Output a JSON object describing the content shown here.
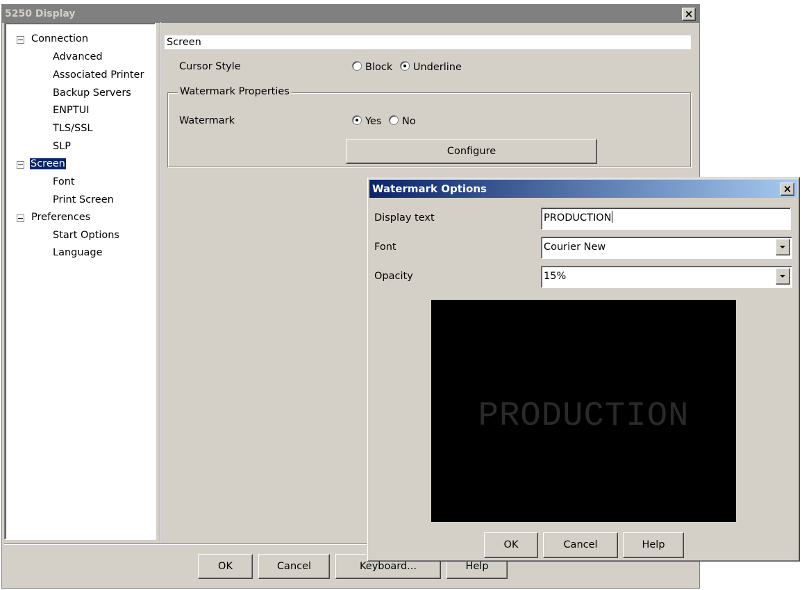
{
  "main_window": {
    "title": "5250 Display",
    "close_label": "×"
  },
  "tree": {
    "connection": {
      "label": "Connection",
      "children": [
        "Advanced",
        "Associated Printer",
        "Backup Servers",
        "ENPTUI",
        "TLS/SSL",
        "SLP"
      ]
    },
    "screen": {
      "label": "Screen",
      "selected": true,
      "children": [
        "Font",
        "Print Screen"
      ]
    },
    "preferences": {
      "label": "Preferences",
      "children": [
        "Start Options",
        "Language"
      ]
    }
  },
  "screen_panel": {
    "header": "Screen",
    "cursor_style": {
      "label": "Cursor Style",
      "options": [
        "Block",
        "Underline"
      ],
      "selected": "Underline"
    },
    "watermark_group": {
      "legend": "Watermark Properties",
      "watermark_label": "Watermark",
      "options": [
        "Yes",
        "No"
      ],
      "selected": "Yes",
      "configure_label": "Configure"
    }
  },
  "main_buttons": {
    "ok": "OK",
    "cancel": "Cancel",
    "keyboard": "Keyboard...",
    "help": "Help"
  },
  "watermark_dialog": {
    "title": "Watermark Options",
    "close_label": "×",
    "display_text_label": "Display text",
    "display_text_value": "PRODUCTION",
    "font_label": "Font",
    "font_value": "Courier New",
    "opacity_label": "Opacity",
    "opacity_value": "15%",
    "preview_text": "PRODUCTION",
    "ok": "OK",
    "cancel": "Cancel",
    "help": "Help"
  },
  "colors": {
    "face": "#d4d0c8",
    "active_title": "#0a246a",
    "inactive_title": "#808080",
    "selection": "#0a246a"
  }
}
